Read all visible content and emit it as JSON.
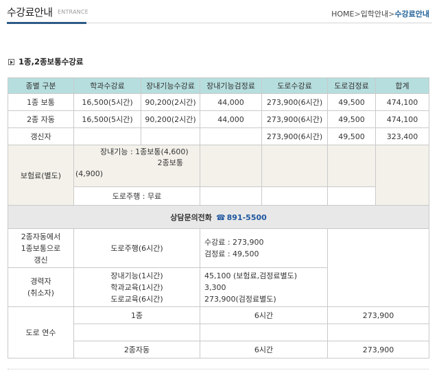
{
  "header": {
    "title": "수강료안내",
    "subtitle": "ENTRANCE",
    "breadcrumb": {
      "home": "HOME",
      "sep": ">",
      "parent": "입학안내",
      "current": "수강료안내"
    }
  },
  "section_title": "1종,2종보통수강료",
  "table": {
    "columns": [
      "종별 구분",
      "학과수강료",
      "장내기능수강료",
      "장내기능검정료",
      "도로수강료",
      "도로검정료",
      "합계"
    ],
    "rows": [
      [
        "1종 보통",
        "16,500(5시간)",
        "90,200(2시간)",
        "44,000",
        "273,900(6시간)",
        "49,500",
        "474,100"
      ],
      [
        "2종 자동",
        "16,500(5시간)",
        "90,200(2시간)",
        "44,000",
        "273,900(6시간)",
        "49,500",
        "474,100"
      ],
      [
        "갱신자",
        "",
        "",
        "",
        "273,900(6시간)",
        "49,500",
        "323,400"
      ]
    ],
    "insurance": {
      "label": "보험료(별도)",
      "line1": "장내기능 : 1종보통(4,600)",
      "line2": "2종보통",
      "line3": "(4,900)",
      "road": "도로주행 : 무료"
    },
    "contact": {
      "label": "상담문의전화",
      "icon": "phone-icon",
      "phone": "891-5500"
    },
    "conversion": {
      "label1": "2종자동에서",
      "label2": "1종보통으로",
      "label3": "갱신",
      "course": "도로주행(6시간)",
      "fee": "수강료 : 273,900",
      "exam": "검정료 :  49,500"
    },
    "experienced": {
      "label1": "경력자",
      "label2": "(취소자)",
      "c1": "장내기능(1시간)",
      "c2": "학과교육(1시간)",
      "c3": "도로교육(6시간)",
      "v1": "45,100 (보험료,검정료별도)",
      "v2": "3,300",
      "v3": "273,900(검정료별도)"
    },
    "road_training": {
      "label": "도로 연수",
      "r1": {
        "type": "1종",
        "hours": "6시간",
        "fee": "273,900"
      },
      "r2": {
        "type": "2종자동",
        "hours": "6시간",
        "fee": "273,900"
      }
    }
  }
}
